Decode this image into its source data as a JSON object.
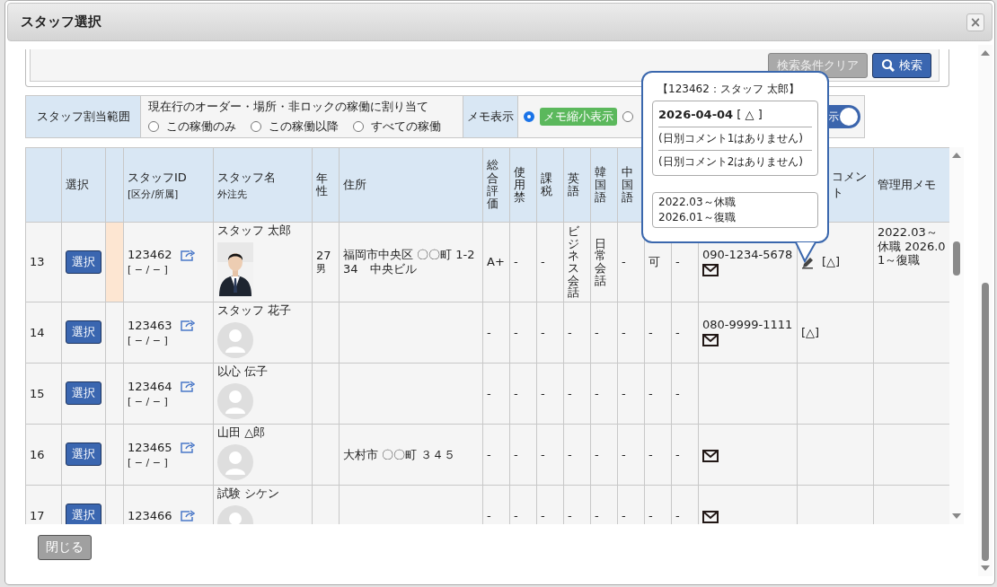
{
  "window": {
    "title": "スタッフ選択",
    "close": "×"
  },
  "search": {
    "buttons": [
      {
        "label": "検索条件クリア",
        "kind": "clear"
      },
      {
        "label": "検索",
        "kind": "search"
      }
    ]
  },
  "assign_range": {
    "label": "スタッフ割当範囲",
    "description": "現在行のオーダー・場所・非ロックの稼働に割り当て",
    "options": [
      {
        "label": "この稼働のみ",
        "selected": false
      },
      {
        "label": "この稼働以降",
        "selected": false
      },
      {
        "label": "すべての稼働",
        "selected": false
      }
    ]
  },
  "memo_display": {
    "label": "メモ表示",
    "options": [
      {
        "label": "メモ縮小表示",
        "selected": true
      },
      {
        "selected": false
      }
    ],
    "toggle": {
      "label": "示",
      "on": true
    }
  },
  "table": {
    "columns": [
      {},
      {
        "label": "選択"
      },
      {},
      {
        "label": "スタッフID",
        "sub": "[区分/所属]"
      },
      {
        "label": "スタッフ名",
        "sub": "外注先"
      },
      {
        "label": "年性",
        "kind": "vertical"
      },
      {
        "label": "住所"
      },
      {
        "label": "総合評価",
        "kind": "vertical"
      },
      {
        "label": "使用禁",
        "kind": "vertical"
      },
      {
        "label": "課税",
        "kind": "vertical"
      },
      {
        "label": "英語",
        "kind": "vertical"
      },
      {
        "label": "韓国語",
        "kind": "vertical"
      },
      {
        "label": "中国語",
        "kind": "vertical"
      },
      {},
      {},
      {},
      {
        "label": "コメント"
      },
      {
        "label": "管理用メモ"
      }
    ],
    "rows": [
      {
        "cells": [
          "13",
          {
            "kind": "button",
            "label": "選択"
          },
          {
            "kind": "marker",
            "marked": true
          },
          {
            "kind": "staff",
            "id": "123462",
            "group": "[ − / − ]"
          },
          {
            "kind": "name",
            "name": "スタッフ 太郎",
            "has_photo": true
          },
          {
            "kind": "age",
            "age": "27",
            "sex": "男"
          },
          "福岡市中央区 〇〇町 1-234　中央ビル",
          "A+",
          "-",
          "-",
          "ビジネス会話",
          "日常会話",
          "-",
          "可",
          "-",
          {
            "kind": "contact",
            "phone": "090-1234-5678",
            "mail": true
          },
          {
            "kind": "comment",
            "editable": true,
            "text": "[△]"
          },
          "2022.03～休職 2026.01～復職"
        ]
      },
      {
        "cells": [
          "14",
          {
            "kind": "button",
            "label": "選択"
          },
          {
            "kind": "marker",
            "marked": false
          },
          {
            "kind": "staff",
            "id": "123463",
            "group": "[ − / − ]"
          },
          {
            "kind": "name",
            "name": "スタッフ 花子",
            "has_photo": false
          },
          "",
          "",
          "-",
          "-",
          "-",
          "-",
          "-",
          "-",
          "-",
          "-",
          {
            "kind": "contact",
            "phone": "080-9999-1111",
            "mail": true
          },
          {
            "kind": "comment",
            "editable": false,
            "text": "[△]"
          },
          ""
        ]
      },
      {
        "cells": [
          "15",
          {
            "kind": "button",
            "label": "選択"
          },
          {
            "kind": "marker",
            "marked": false
          },
          {
            "kind": "staff",
            "id": "123464",
            "group": "[ − / − ]"
          },
          {
            "kind": "name",
            "name": "以心 伝子",
            "has_photo": false
          },
          "",
          "",
          "-",
          "-",
          "-",
          "-",
          "-",
          "-",
          "-",
          "-",
          {
            "kind": "contact",
            "mail": false
          },
          "",
          ""
        ]
      },
      {
        "cells": [
          "16",
          {
            "kind": "button",
            "label": "選択"
          },
          {
            "kind": "marker",
            "marked": false
          },
          {
            "kind": "staff",
            "id": "123465",
            "group": "[ − / − ]"
          },
          {
            "kind": "name",
            "name": "山田 △郎",
            "has_photo": false
          },
          "",
          "大村市 〇〇町 ３４５",
          "-",
          "-",
          "-",
          "-",
          "-",
          "-",
          "-",
          "-",
          {
            "kind": "contact",
            "mail": true
          },
          "",
          ""
        ]
      },
      {
        "cells": [
          "17",
          {
            "kind": "button",
            "label": "選択"
          },
          {
            "kind": "marker",
            "marked": false
          },
          {
            "kind": "staff",
            "id": "123466"
          },
          {
            "kind": "name",
            "name": "試験 シケン",
            "has_photo": false
          },
          "",
          "",
          "-",
          "-",
          "-",
          "-",
          "-",
          "-",
          "-",
          "-",
          {
            "kind": "contact",
            "mail": true
          },
          "",
          ""
        ]
      }
    ]
  },
  "popup": {
    "title": "【123462：スタッフ 太郎】",
    "date": "2026-04-04",
    "mark": "[ △ ]",
    "comments": [
      "(日別コメント1はありません)",
      "(日別コメント2はありません)"
    ],
    "memo_lines": [
      "2022.03～休職",
      "2026.01～復職"
    ]
  },
  "footer": {
    "close_button": "閉じる"
  }
}
